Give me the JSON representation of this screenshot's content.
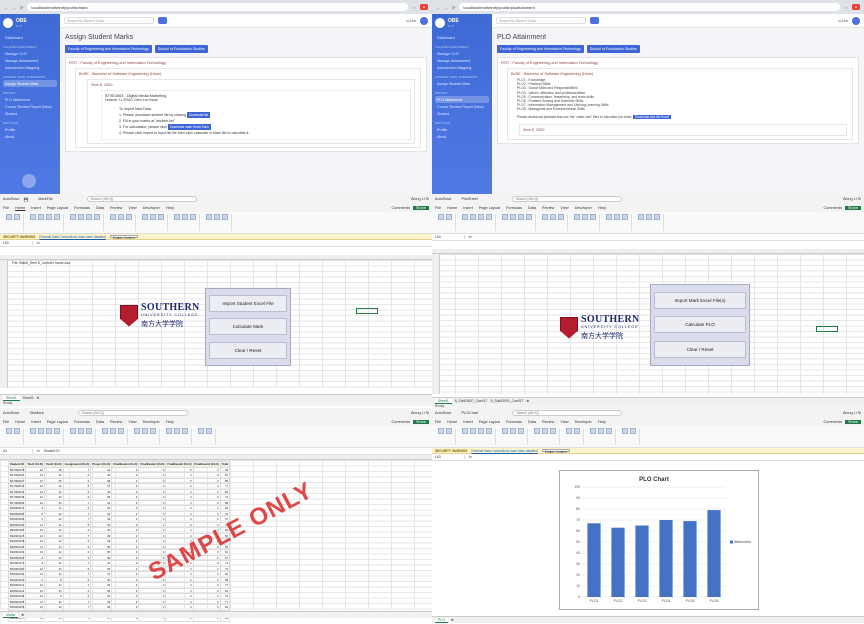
{
  "browser_left": {
    "url": "localhost/markentry/public/mark",
    "tabs_badge": "Other bookmarks",
    "sidebar": {
      "brand": "OBE",
      "brand_sub": "• • •",
      "items": [
        {
          "label": "Dashboard",
          "section": ""
        },
        {
          "label": "Manage CLO",
          "section": "COURSE ASSESSMENT"
        },
        {
          "label": "Manage Assessment",
          "section": ""
        },
        {
          "label": "Assessment Mapping",
          "section": ""
        },
        {
          "label": "Assign Student Mark",
          "section": "ANSWER MARK SUBMISSION"
        },
        {
          "label": "PLO Attainment",
          "section": "REPORT"
        },
        {
          "label": "Course Review Report (New)",
          "section": ""
        },
        {
          "label": "Student",
          "section": ""
        },
        {
          "label": "Profile",
          "section": "SETTINGS"
        },
        {
          "label": "About",
          "section": ""
        }
      ]
    },
    "search_placeholder": "Search by Student Code",
    "user": "sj.k3at",
    "page_title": "Assign Student Marks",
    "faculties": [
      "Faculty of Engineering and Information Technology",
      "School of Foundation Studies"
    ],
    "faculty_box": "FEIT - Faculty of Engineering and Information Technology",
    "program": "BoSE - Bachelor of Software Engineering (Hons)",
    "semester": "Sem 8, 2020",
    "course_code": "BTSE3063 - Digital Media Marketing",
    "lecturer": "Lecturer: LI ZHUO Chen Lon Kwan",
    "howto_title": "To Import New Data:",
    "steps": [
      "1. Please download student list by clicking",
      "2. Fill in your marks at \"student list\"",
      "3. For calculation, please click",
      "4. Please click Import to input list file then click calculate in Mark file to calculate it."
    ],
    "download_label": "Download list",
    "download_file_label": "Download mark Excel Each"
  },
  "browser_right": {
    "url": "localhost/markentry/public/ploattainment",
    "page_title": "PLO Attainment",
    "faculties": [
      "Faculty of Engineering and Information Technology",
      "School of Foundation Studies"
    ],
    "faculty_box": "FEIT - Faculty of Engineering and Information Technology",
    "program": "BoSE - Bachelor of Software Engineering (Hons)",
    "plos": [
      "PLO1 : Knowledge",
      "PLO2 : Practical Skills",
      "PLO3 : Social Skills and Responsibilities",
      "PLO4 : Values, attitudes, and professionalism",
      "PLO5 : Communication, leadership, and team skills",
      "PLO6 : Problem Solving and Scientific Skills",
      "PLO7 : Information Management and Lifelong Learning Skills",
      "PLO8 : Managerial and Entrepreneurial Skills"
    ],
    "instruction": "Please download plotdata and use the \"mark.xlsx\" files to calculate plo chart:",
    "download_label": "Download plot file Excel",
    "semester": "Sem 8, 2020"
  },
  "excel_left": {
    "app": "AutoSave",
    "file": "MarkFile",
    "search": "Search (Alt+Q)",
    "user": "Wong Li Si",
    "menu": [
      "File",
      "Home",
      "Insert",
      "Page Layout",
      "Formulas",
      "Data",
      "Review",
      "View",
      "Developer",
      "Help"
    ],
    "comments": "Comments",
    "share": "Share",
    "warning": "SECURITY WARNING",
    "warning_link": "External Data Connections have been disabled",
    "enable": "Enable Content",
    "cell_ref": "L63",
    "a1": "File: Batch_Sem 8_Lecturer name.xlsx",
    "university": "SOUTHERN",
    "university_sub": "UNIVERSITY COLLEGE",
    "university_cn": "南方大学学院",
    "buttons": [
      "Import Student Excel File",
      "Calculate Mark",
      "Clear / Reset"
    ],
    "sheets": [
      "Sheet1",
      "Sheet2"
    ],
    "status": "Ready"
  },
  "excel_right": {
    "file": "PiloSheet",
    "search": "Search (Alt+Q)",
    "user": "Wong Li Si",
    "buttons": [
      "Import Mark Excel File(s)",
      "Calculate PLO",
      "Clear / Reset"
    ],
    "sheets": [
      "Sheet1",
      "5_Sub03007_Cse017",
      "5_Sub03001_Cse017"
    ],
    "status": "Ready"
  },
  "excel_marks": {
    "file": "StuMark",
    "cell_ref": "A1",
    "formula": "Student ID",
    "headers": [
      "Student ID",
      "Test1 (CLO)",
      "Test2 (CLO)",
      "Assignment (CLO)",
      "Project (CLO)",
      "FinalExam1 (CLO)",
      "FinalExam2 (CLO)",
      "FinalExam3 (CLO)",
      "FinalExam4 (CLO)",
      "Total"
    ],
    "rows": [
      [
        "B17990018",
        "15",
        "15",
        "7",
        "42",
        "3",
        "3",
        "5",
        "3",
        "93"
      ],
      [
        "B17990021",
        "14",
        "14",
        "6",
        "40",
        "3",
        "3",
        "4",
        "3",
        "87"
      ],
      [
        "B17990027",
        "13",
        "15",
        "6",
        "38",
        "2",
        "3",
        "5",
        "3",
        "85"
      ],
      [
        "B17990032",
        "12",
        "12",
        "5",
        "37",
        "3",
        "2",
        "3",
        "3",
        "77"
      ],
      [
        "B17990041",
        "13",
        "14",
        "6",
        "39",
        "3",
        "3",
        "4",
        "2",
        "84"
      ],
      [
        "B17990045",
        "10",
        "10",
        "6",
        "35",
        "3",
        "3",
        "4",
        "3",
        "74"
      ],
      [
        "B17990052",
        "14",
        "13",
        "7",
        "41",
        "3",
        "3",
        "4",
        "3",
        "88"
      ],
      [
        "B18000071",
        "9",
        "11",
        "5",
        "33",
        "2",
        "3",
        "4",
        "2",
        "69"
      ],
      [
        "B18000084",
        "8",
        "12",
        "7",
        "32",
        "2",
        "3",
        "3",
        "3",
        "70"
      ],
      [
        "B18000096",
        "5",
        "12",
        "7",
        "32",
        "2",
        "3",
        "4",
        "2",
        "67"
      ],
      [
        "B18000103",
        "11",
        "12",
        "6",
        "34",
        "3",
        "2",
        "4",
        "3",
        "75"
      ],
      [
        "B18000118",
        "15",
        "12",
        "6",
        "40",
        "3",
        "3",
        "3",
        "2",
        "84"
      ],
      [
        "B18000126",
        "14",
        "13",
        "7",
        "36",
        "2",
        "3",
        "4",
        "3",
        "82"
      ],
      [
        "B18000138",
        "13",
        "13",
        "5",
        "33",
        "3",
        "2",
        "3",
        "2",
        "74"
      ],
      [
        "B18000146",
        "11",
        "14",
        "6",
        "36",
        "3",
        "3",
        "4",
        "3",
        "80"
      ],
      [
        "B18000151",
        "13",
        "14",
        "6",
        "35",
        "3",
        "3",
        "4",
        "3",
        "81"
      ],
      [
        "B18000163",
        "9",
        "12",
        "6",
        "30",
        "2",
        "3",
        "3",
        "2",
        "67"
      ],
      [
        "B18000172",
        "9",
        "12",
        "7",
        "31",
        "2",
        "3",
        "4",
        "3",
        "71"
      ],
      [
        "B18000180",
        "14",
        "10",
        "5",
        "35",
        "2",
        "2",
        "3",
        "2",
        "73"
      ],
      [
        "B18000191",
        "11",
        "14",
        "7",
        "37",
        "2",
        "3",
        "4",
        "3",
        "81"
      ],
      [
        "B18000200",
        "6",
        "8",
        "6",
        "30",
        "2",
        "2",
        "3",
        "2",
        "59"
      ],
      [
        "B18000211",
        "12",
        "11",
        "7",
        "34",
        "3",
        "3",
        "4",
        "3",
        "77"
      ],
      [
        "B18000222",
        "13",
        "13",
        "6",
        "36",
        "3",
        "3",
        "4",
        "3",
        "81"
      ],
      [
        "B18000234",
        "12",
        "9",
        "6",
        "33",
        "2",
        "3",
        "4",
        "3",
        "72"
      ],
      [
        "B18000245",
        "11",
        "12",
        "7",
        "35",
        "3",
        "3",
        "4",
        "2",
        "77"
      ],
      [
        "B18000256",
        "13",
        "13",
        "7",
        "36",
        "3",
        "2",
        "4",
        "3",
        "81"
      ],
      [
        "B18000264",
        "11",
        "7",
        "7",
        "32",
        "2",
        "3",
        "3",
        "2",
        "67"
      ],
      [
        "B18000275",
        "13",
        "14",
        "6",
        "37",
        "3",
        "3",
        "4",
        "3",
        "83"
      ]
    ],
    "watermark": "SAMPLE ONLY",
    "sheets": [
      "Marks"
    ]
  },
  "excel_chart": {
    "file": "PLOChart",
    "sheets": [
      "PLO"
    ],
    "chart_data": {
      "type": "bar",
      "title": "PLO Chart",
      "categories": [
        "PLO1",
        "PLO2",
        "PLO3",
        "PLO4",
        "PLO5",
        "PLO6"
      ],
      "values": [
        67,
        63,
        65,
        70,
        69,
        79
      ],
      "ylim": [
        0,
        100
      ],
      "yticks": [
        0,
        10,
        20,
        30,
        40,
        50,
        60,
        70,
        80,
        90,
        100
      ],
      "legend": "Attainment",
      "legend_position": "right",
      "color": "#4472c4"
    }
  }
}
